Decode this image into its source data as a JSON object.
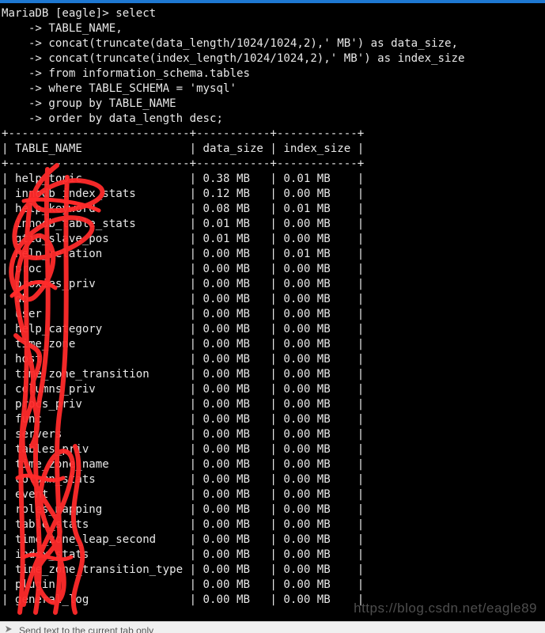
{
  "prompt": "MariaDB [eagle]> select",
  "query_lines": [
    "    -> TABLE_NAME,",
    "    -> concat(truncate(data_length/1024/1024,2),' MB') as data_size,",
    "    -> concat(truncate(index_length/1024/1024,2),' MB') as index_size",
    "    -> from information_schema.tables",
    "    -> where TABLE_SCHEMA = 'mysql'",
    "    -> group by TABLE_NAME",
    "    -> order by data_length desc;"
  ],
  "table": {
    "columns": [
      "TABLE_NAME",
      "data_size",
      "index_size"
    ],
    "rows": [
      [
        "help_topic",
        "0.38 MB",
        "0.01 MB"
      ],
      [
        "innodb_index_stats",
        "0.12 MB",
        "0.00 MB"
      ],
      [
        "help_keyword",
        "0.08 MB",
        "0.01 MB"
      ],
      [
        "innodb_table_stats",
        "0.01 MB",
        "0.00 MB"
      ],
      [
        "gtid_slave_pos",
        "0.01 MB",
        "0.00 MB"
      ],
      [
        "help_relation",
        "0.00 MB",
        "0.01 MB"
      ],
      [
        "proc",
        "0.00 MB",
        "0.00 MB"
      ],
      [
        "proxies_priv",
        "0.00 MB",
        "0.00 MB"
      ],
      [
        "db",
        "0.00 MB",
        "0.00 MB"
      ],
      [
        "user",
        "0.00 MB",
        "0.00 MB"
      ],
      [
        "help_category",
        "0.00 MB",
        "0.00 MB"
      ],
      [
        "time_zone",
        "0.00 MB",
        "0.00 MB"
      ],
      [
        "host",
        "0.00 MB",
        "0.00 MB"
      ],
      [
        "time_zone_transition",
        "0.00 MB",
        "0.00 MB"
      ],
      [
        "columns_priv",
        "0.00 MB",
        "0.00 MB"
      ],
      [
        "procs_priv",
        "0.00 MB",
        "0.00 MB"
      ],
      [
        "func",
        "0.00 MB",
        "0.00 MB"
      ],
      [
        "servers",
        "0.00 MB",
        "0.00 MB"
      ],
      [
        "tables_priv",
        "0.00 MB",
        "0.00 MB"
      ],
      [
        "time_zone_name",
        "0.00 MB",
        "0.00 MB"
      ],
      [
        "column_stats",
        "0.00 MB",
        "0.00 MB"
      ],
      [
        "event",
        "0.00 MB",
        "0.00 MB"
      ],
      [
        "roles_mapping",
        "0.00 MB",
        "0.00 MB"
      ],
      [
        "table_stats",
        "0.00 MB",
        "0.00 MB"
      ],
      [
        "time_zone_leap_second",
        "0.00 MB",
        "0.00 MB"
      ],
      [
        "index_stats",
        "0.00 MB",
        "0.00 MB"
      ],
      [
        "time_zone_transition_type",
        "0.00 MB",
        "0.00 MB"
      ],
      [
        "plugin",
        "0.00 MB",
        "0.00 MB"
      ],
      [
        "general_log",
        "0.00 MB",
        "0.00 MB"
      ]
    ]
  },
  "watermark": "https://blog.csdn.net/eagle89",
  "send_bar": {
    "text": "Send text to the current tab only",
    "icon": "send-icon"
  },
  "colors": {
    "terminal_bg": "#000000",
    "terminal_text": "#e8e8e8",
    "scribble": "#ff2a2a",
    "title_accent": "#1e78d2"
  }
}
